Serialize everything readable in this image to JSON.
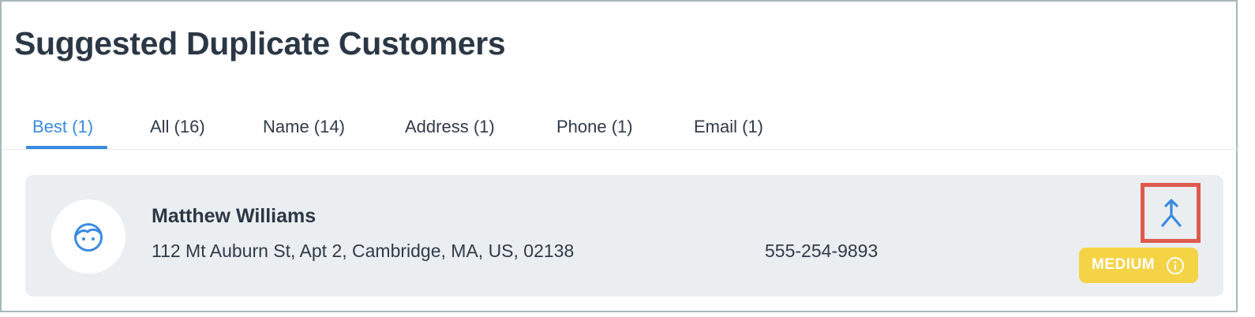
{
  "page": {
    "title": "Suggested Duplicate Customers"
  },
  "tabs": [
    {
      "label": "Best (1)",
      "active": true
    },
    {
      "label": "All (16)",
      "active": false
    },
    {
      "label": "Name (14)",
      "active": false
    },
    {
      "label": "Address (1)",
      "active": false
    },
    {
      "label": "Phone (1)",
      "active": false
    },
    {
      "label": "Email (1)",
      "active": false
    }
  ],
  "duplicate": {
    "avatar_icon": "face-icon",
    "name": "Matthew Williams",
    "address": "112 Mt Auburn St, Apt 2, Cambridge, MA, US, 02138",
    "phone": "555-254-9893",
    "merge_icon": "merge-icon",
    "match_level": "MEDIUM",
    "info_icon": "info-icon"
  },
  "colors": {
    "accent": "#3a8be0",
    "highlight_border": "#dd5b4e",
    "badge_medium": "#f5d346",
    "card_background": "#ebeef1",
    "text_primary": "#2b3745"
  }
}
